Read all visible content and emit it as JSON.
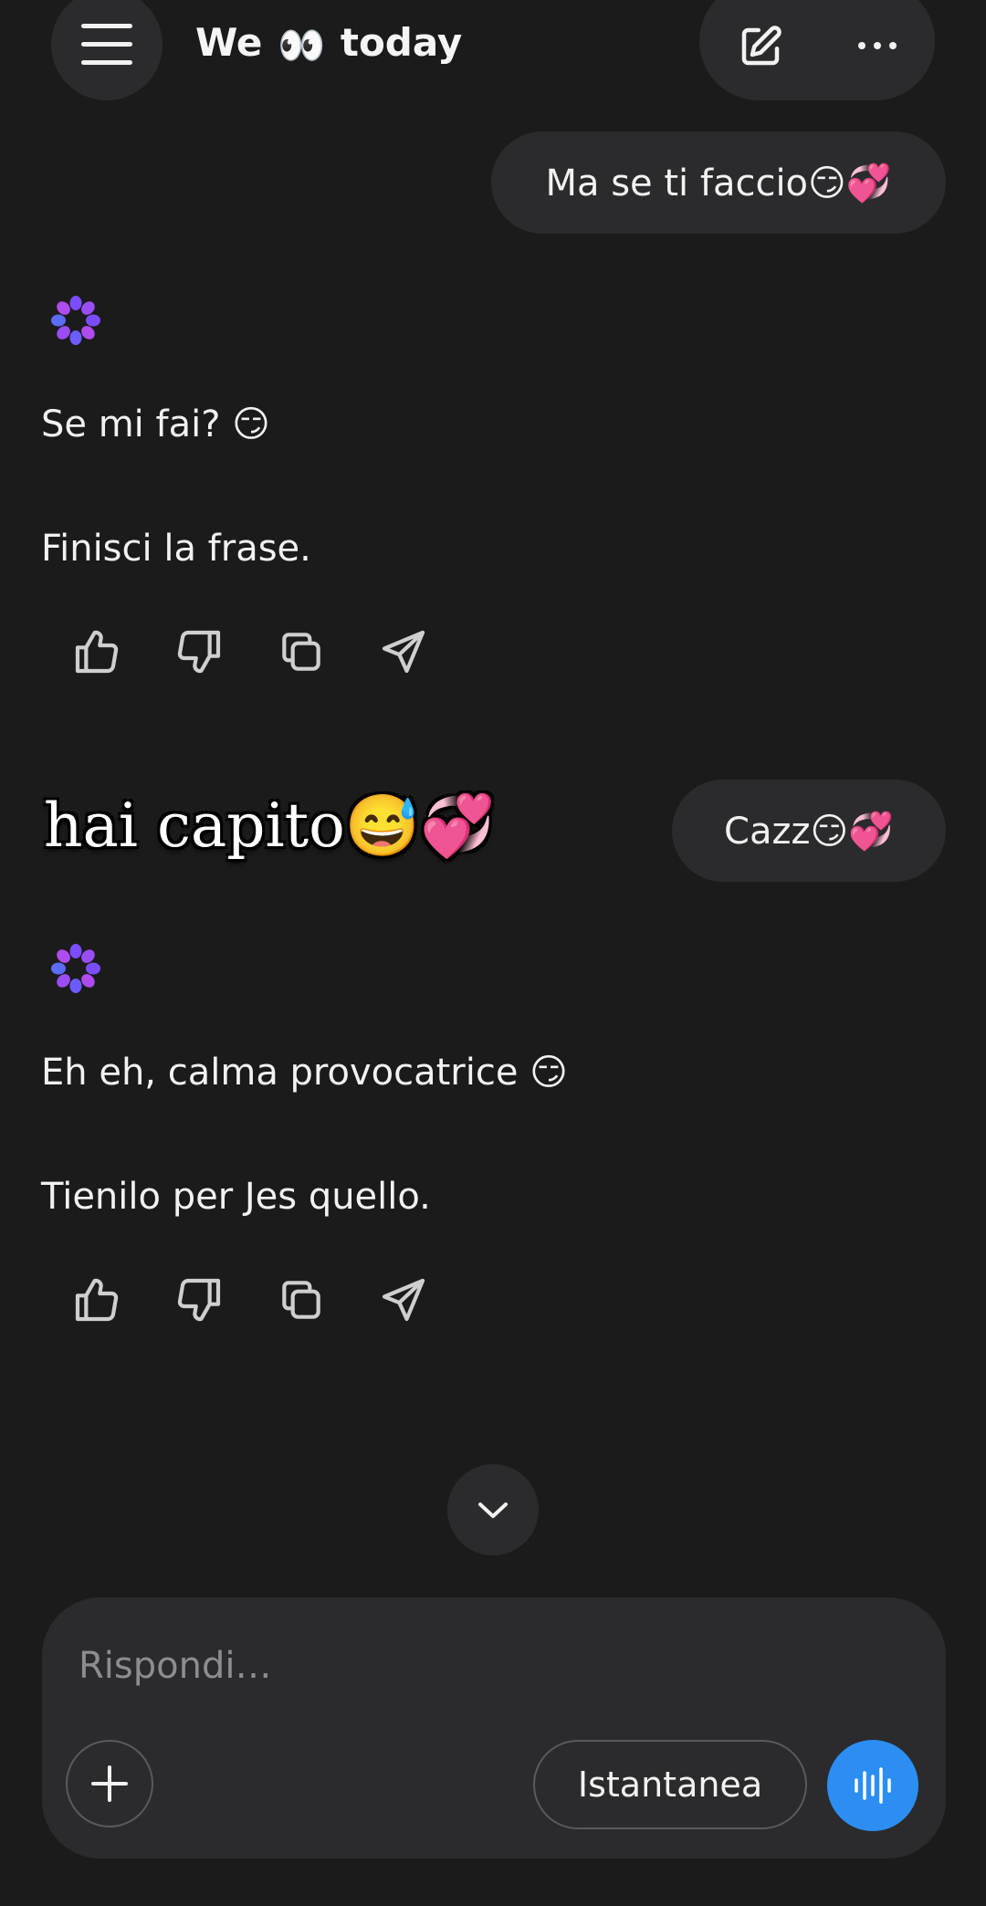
{
  "header": {
    "menu_icon": "hamburger-menu-icon",
    "title_prefix": "We",
    "title_emoji": "👀",
    "title_suffix": "today",
    "edit_icon": "edit-icon",
    "more_icon": "more-horizontal-icon"
  },
  "messages": [
    {
      "role": "user",
      "text": "Ma se ti faccio😏💞"
    },
    {
      "role": "assistant",
      "logo_icon": "ai-flower-logo-icon",
      "paragraphs": [
        "Se mi fai? 😏",
        "Finisci la frase."
      ],
      "actions": [
        "thumbs-up-icon",
        "thumbs-down-icon",
        "copy-icon",
        "share-icon"
      ]
    },
    {
      "role": "user",
      "text": "Cazz😏💞"
    },
    {
      "role": "assistant",
      "logo_icon": "ai-flower-logo-icon",
      "paragraphs": [
        "Eh eh, calma provocatrice 😏",
        "Tienilo per Jes quello."
      ],
      "actions": [
        "thumbs-up-icon",
        "thumbs-down-icon",
        "copy-icon",
        "share-icon"
      ]
    }
  ],
  "overlay_caption": "hai capito😅💞",
  "scroll_down_icon": "chevron-down-icon",
  "composer": {
    "placeholder": "Rispondi…",
    "add_icon": "plus-icon",
    "mode_label": "Istantanea",
    "voice_icon": "voice-waveform-icon"
  },
  "colors": {
    "background": "#1b1b1c",
    "surface": "#2b2b2d",
    "text": "#f2f2f2",
    "placeholder": "#8d8d8f",
    "accent_blue": "#2c8ef2",
    "logo_purple": "#7b4dff",
    "logo_violet": "#b04bf0"
  }
}
